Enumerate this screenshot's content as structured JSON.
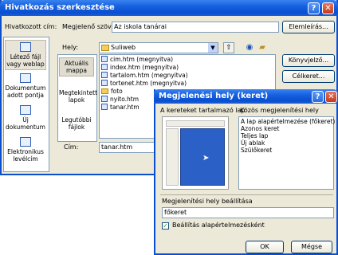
{
  "main_dialog": {
    "title": "Hivatkozás szerkesztése",
    "link_to_label": "Hivatkozott cím:",
    "display_text_label": "Megjelenő szöveg:",
    "display_text_value": "Az iskola tanárai",
    "screentip_button": "Elemleírás...",
    "look_in_label": "Hely:",
    "look_in_value": "Suliweb",
    "bookmark_button": "Könyvjelző...",
    "target_frame_button": "Célkeret...",
    "address_label": "Cím:",
    "address_value": "tanar.htm",
    "sidebar": [
      {
        "label": "Létező fájl vagy weblap",
        "icon": "existing-file-icon"
      },
      {
        "label": "Dokumentum adott pontja",
        "icon": "document-place-icon"
      },
      {
        "label": "Új dokumentum",
        "icon": "new-document-icon"
      },
      {
        "label": "Elektronikus levélcím",
        "icon": "email-icon"
      }
    ],
    "middle": [
      {
        "label": "Aktuális mappa"
      },
      {
        "label": "Megtekintett lapok"
      },
      {
        "label": "Legutóbbi fájlok"
      }
    ],
    "files": [
      {
        "name": "cim.htm (megnyitva)",
        "type": "page"
      },
      {
        "name": "index.htm (megnyitva)",
        "type": "page"
      },
      {
        "name": "tartalom.htm (megnyitva)",
        "type": "page"
      },
      {
        "name": "tortenet.htm (megnyitva)",
        "type": "page"
      },
      {
        "name": "foto",
        "type": "folder"
      },
      {
        "name": "nyito.htm",
        "type": "page"
      },
      {
        "name": "tanar.htm",
        "type": "page"
      }
    ]
  },
  "frame_dialog": {
    "title": "Megjelenési hely (keret)",
    "frames_page_label": "A kereteket tartalmazó lap",
    "common_targets_label": "Közös megjelenítési hely",
    "targets": [
      "A lap alapértelmezése (főkeret)",
      "Azonos keret",
      "Teljes lap",
      "Új ablak",
      "Szülőkeret"
    ],
    "target_setting_label": "Megjelenítési hely beállítása",
    "target_setting_value": "főkeret",
    "set_default_label": "Beállítás alapértelmezésként",
    "set_default_checked": true,
    "ok_button": "OK",
    "cancel_button": "Mégse"
  },
  "colors": {
    "xp_blue": "#0a4fd0",
    "selected_frame": "#2b61c6",
    "dialog_bg": "#ece9d8"
  }
}
